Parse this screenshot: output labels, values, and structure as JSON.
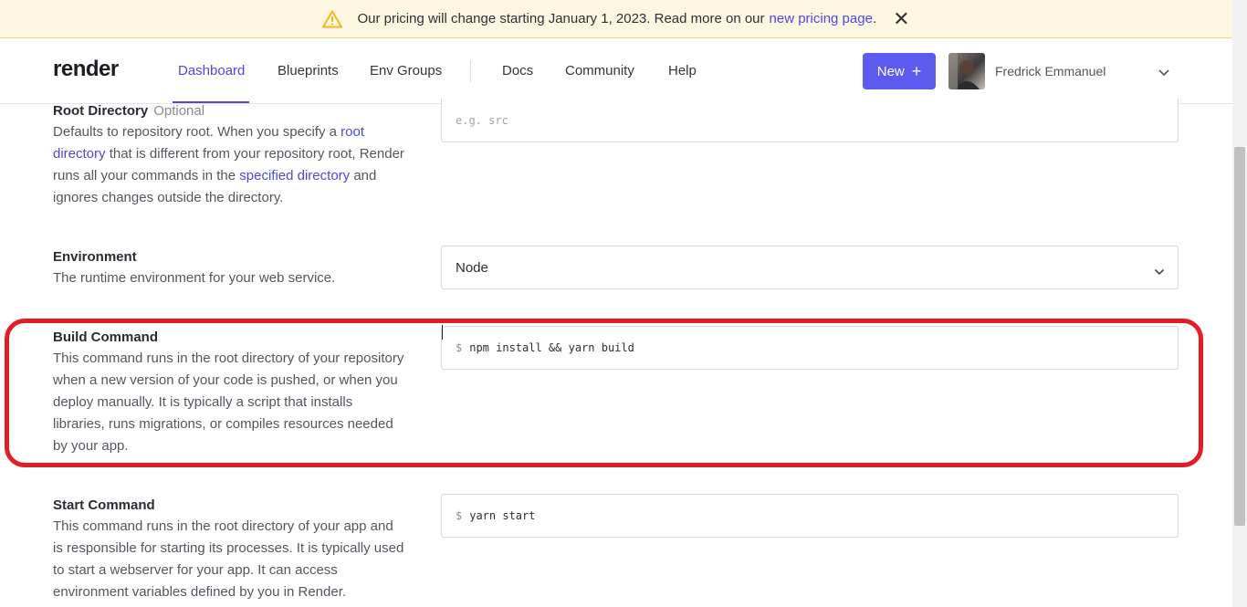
{
  "banner": {
    "message": "Our pricing will change starting January 1, 2023. Read more on our",
    "link_text": "new pricing page",
    "suffix": ".",
    "warning_color": "#f5b623"
  },
  "header": {
    "logo": "render",
    "nav": [
      "Dashboard",
      "Blueprints",
      "Env Groups",
      "Docs",
      "Community",
      "Help"
    ],
    "active_nav": "Dashboard",
    "new_button": "New",
    "user_name": "Fredrick Emmanuel",
    "accent_color": "#4f46e5"
  },
  "root_directory": {
    "title": "Root Directory",
    "optional": "Optional",
    "desc_1": "Defaults to repository root. When you specify a",
    "link_1": "root directory",
    "desc_2": "that is different from your repository root, Render runs all your commands in the",
    "link_2": "specified directory",
    "desc_3": "and ignores changes outside the directory.",
    "placeholder": "e.g. src"
  },
  "environment": {
    "title": "Environment",
    "desc": "The runtime environment for your web service.",
    "value": "Node"
  },
  "build_command": {
    "title": "Build Command",
    "desc": "This command runs in the root directory of your repository when a new version of your code is pushed, or when you deploy manually. It is typically a script that installs libraries, runs migrations, or compiles resources needed by your app.",
    "prefix": "$",
    "value": "npm install && yarn build",
    "highlight_color": "#e11d2a"
  },
  "start_command": {
    "title": "Start Command",
    "desc": "This command runs in the root directory of your app and is responsible for starting its processes. It is typically used to start a webserver for your app. It can access environment variables defined by you in Render.",
    "prefix": "$",
    "value": "yarn start"
  }
}
